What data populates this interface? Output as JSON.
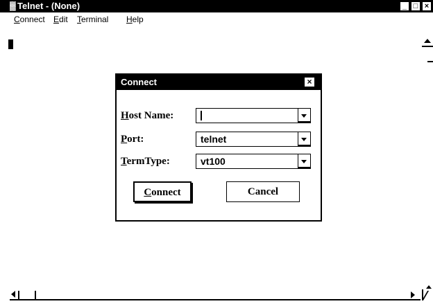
{
  "window": {
    "title": "Telnet - (None)",
    "minimize_glyph": "_",
    "maximize_glyph": "□",
    "close_glyph": "×"
  },
  "menu": [
    {
      "label": "Connect",
      "accel": "C",
      "rest": "onnect"
    },
    {
      "label": "Edit",
      "accel": "E",
      "rest": "dit"
    },
    {
      "label": "Terminal",
      "accel": "T",
      "rest": "erminal"
    },
    {
      "label": "Help",
      "accel": "H",
      "rest": "elp"
    }
  ],
  "dialog": {
    "title": "Connect",
    "close_glyph": "×",
    "fields": [
      {
        "label": "Host Name:",
        "accel": "H",
        "rest": "ost Name:",
        "value": ""
      },
      {
        "label": "Port:",
        "accel": "P",
        "rest": "ort:",
        "value": "telnet"
      },
      {
        "label": "TermType:",
        "accel": "T",
        "rest": "ermType:",
        "value": "vt100"
      }
    ],
    "connect_button": {
      "label": "Connect",
      "accel": "C",
      "rest": "onnect"
    },
    "cancel_button": {
      "label": "Cancel"
    }
  },
  "icons": {
    "app": "telnet-app-icon",
    "dropdown": "chevron-down-icon"
  }
}
